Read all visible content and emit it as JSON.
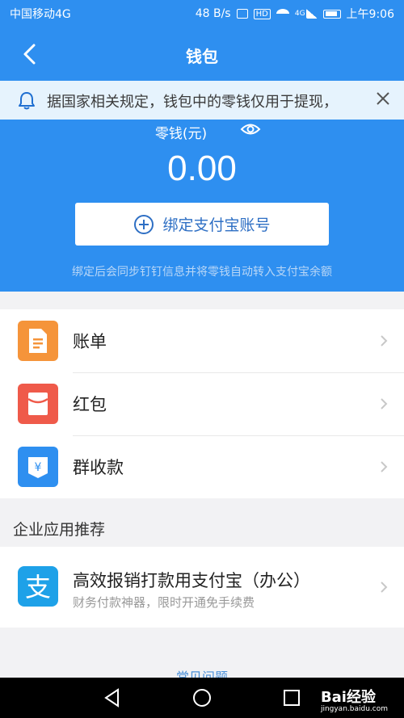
{
  "status_bar": {
    "carrier": "中国移动4G",
    "speed": "48 B/s",
    "hd": "HD",
    "network": "4G",
    "time": "上午9:06"
  },
  "nav": {
    "title": "钱包"
  },
  "notice": {
    "text": "据国家相关规定，钱包中的零钱仅用于提现，"
  },
  "wallet": {
    "balance_label": "零钱(元)",
    "balance": "0.00",
    "bind_button": "绑定支付宝账号",
    "bind_hint": "绑定后会同步钉钉信息并将零钱自动转入支付宝余额"
  },
  "menu": {
    "items": [
      {
        "label": "账单",
        "icon": "bill-icon",
        "color": "#f5943a"
      },
      {
        "label": "红包",
        "icon": "red-packet-icon",
        "color": "#ef5a4a"
      },
      {
        "label": "群收款",
        "icon": "group-payment-icon",
        "color": "#2e8ff0"
      }
    ]
  },
  "section": {
    "title": "企业应用推荐"
  },
  "promo": {
    "title": "高效报销打款用支付宝（办公）",
    "subtitle": "财务付款神器，限时开通免手续费",
    "icon": "alipay-icon",
    "icon_glyph": "支"
  },
  "footer": {
    "faq": "常见问题"
  },
  "watermark": {
    "brand": "Bai",
    "brand_suffix": "经验",
    "url": "jingyan.baidu.com"
  },
  "colors": {
    "primary": "#2e8ff0",
    "notice_bg": "#e6f3fd"
  }
}
